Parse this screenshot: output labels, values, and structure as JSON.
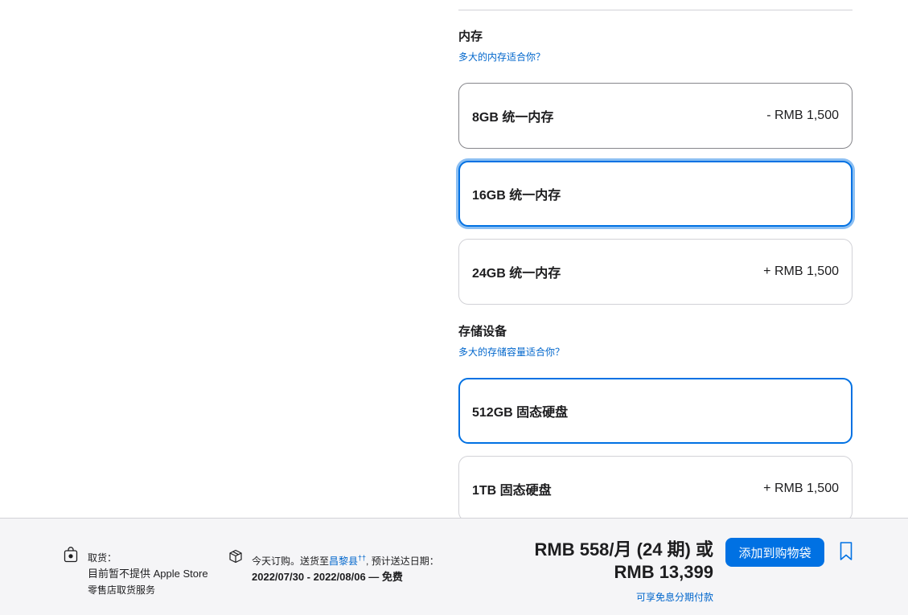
{
  "memory": {
    "title": "内存",
    "help": "多大的内存适合你？",
    "options": [
      {
        "label": "8GB 统一内存",
        "price": "- RMB 1,500"
      },
      {
        "label": "16GB 统一内存",
        "price": ""
      },
      {
        "label": "24GB 统一内存",
        "price": "+ RMB 1,500"
      }
    ]
  },
  "storage": {
    "title": "存储设备",
    "help": "多大的存储容量适合你？",
    "options": [
      {
        "label": "512GB 固态硬盘",
        "price": ""
      },
      {
        "label": "1TB 固态硬盘",
        "price": "+ RMB 1,500"
      }
    ]
  },
  "bottom": {
    "pickup_title": "取货：",
    "pickup_line1": "目前暂不提供 Apple Store",
    "pickup_line2": "零售店取货服务",
    "ship_prefix": "今天订购。送货至",
    "ship_location": "昌黎县",
    "ship_mark": "††",
    "ship_suffix": ", 预计送达日期：",
    "ship_dates": "2022/07/30 - 2022/08/06 — 免费",
    "price_line1": "RMB 558/月 (24 期) 或",
    "price_line2": "RMB 13,399",
    "finance_link": "可享免息分期付款",
    "add_button": "添加到购物袋"
  },
  "colors": {
    "accent": "#0071e3",
    "link": "#0066cc",
    "bar_bg": "#f5f5f7"
  },
  "icons": {
    "pickup": "shopping-bag-icon",
    "shipping": "box-icon",
    "save": "bookmark-icon"
  }
}
